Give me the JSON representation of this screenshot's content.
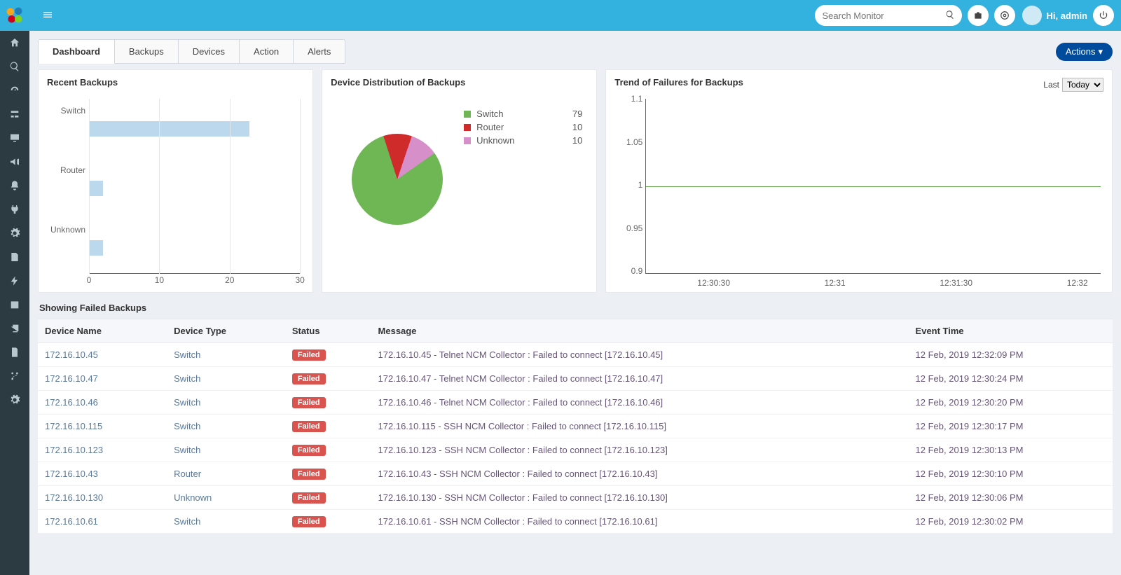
{
  "header": {
    "search_placeholder": "Search Monitor",
    "greeting": "Hi, admin"
  },
  "tabs": [
    "Dashboard",
    "Backups",
    "Devices",
    "Action",
    "Alerts"
  ],
  "active_tab": "Dashboard",
  "actions_label": "Actions",
  "panel_titles": {
    "recent": "Recent Backups",
    "distribution": "Device Distribution of Backups",
    "trend": "Trend of Failures for Backups"
  },
  "trend_controls": {
    "label": "Last",
    "selected": "Today"
  },
  "failed_title": "Showing Failed Backups",
  "table_headers": {
    "device": "Device Name",
    "type": "Device Type",
    "status": "Status",
    "message": "Message",
    "time": "Event Time"
  },
  "status_failed_label": "Failed",
  "chart_data": {
    "recent_backups": {
      "type": "bar",
      "orientation": "horizontal",
      "categories": [
        "Switch",
        "Router",
        "Unknown"
      ],
      "values": [
        23,
        2,
        2
      ],
      "xlim": [
        0,
        30
      ],
      "xticks": [
        0,
        10,
        20,
        30
      ]
    },
    "distribution": {
      "type": "pie",
      "series": [
        {
          "name": "Switch",
          "value": 79,
          "color": "#6fb755"
        },
        {
          "name": "Router",
          "value": 10,
          "color": "#d02b2b"
        },
        {
          "name": "Unknown",
          "value": 10,
          "color": "#d68fc9"
        }
      ]
    },
    "trend": {
      "type": "line",
      "ylim": [
        0.9,
        1.1
      ],
      "yticks": [
        0.9,
        0.95,
        1,
        1.05,
        1.1
      ],
      "xticks": [
        "12:30:30",
        "12:31",
        "12:31:30",
        "12:32"
      ],
      "series": [
        {
          "name": "failures",
          "color": "#6aa84f",
          "flat_value": 1
        }
      ]
    }
  },
  "failed_rows": [
    {
      "device": "172.16.10.45",
      "type": "Switch",
      "message": "172.16.10.45 - Telnet NCM Collector : Failed to connect [172.16.10.45]",
      "time": "12 Feb, 2019 12:32:09 PM"
    },
    {
      "device": "172.16.10.47",
      "type": "Switch",
      "message": "172.16.10.47 - Telnet NCM Collector : Failed to connect [172.16.10.47]",
      "time": "12 Feb, 2019 12:30:24 PM"
    },
    {
      "device": "172.16.10.46",
      "type": "Switch",
      "message": "172.16.10.46 - Telnet NCM Collector : Failed to connect [172.16.10.46]",
      "time": "12 Feb, 2019 12:30:20 PM"
    },
    {
      "device": "172.16.10.115",
      "type": "Switch",
      "message": "172.16.10.115 - SSH NCM Collector : Failed to connect [172.16.10.115]",
      "time": "12 Feb, 2019 12:30:17 PM"
    },
    {
      "device": "172.16.10.123",
      "type": "Switch",
      "message": "172.16.10.123 - SSH NCM Collector : Failed to connect [172.16.10.123]",
      "time": "12 Feb, 2019 12:30:13 PM"
    },
    {
      "device": "172.16.10.43",
      "type": "Router",
      "message": "172.16.10.43 - SSH NCM Collector : Failed to connect [172.16.10.43]",
      "time": "12 Feb, 2019 12:30:10 PM"
    },
    {
      "device": "172.16.10.130",
      "type": "Unknown",
      "message": "172.16.10.130 - SSH NCM Collector : Failed to connect [172.16.10.130]",
      "time": "12 Feb, 2019 12:30:06 PM"
    },
    {
      "device": "172.16.10.61",
      "type": "Switch",
      "message": "172.16.10.61 - SSH NCM Collector : Failed to connect [172.16.10.61]",
      "time": "12 Feb, 2019 12:30:02 PM"
    }
  ]
}
